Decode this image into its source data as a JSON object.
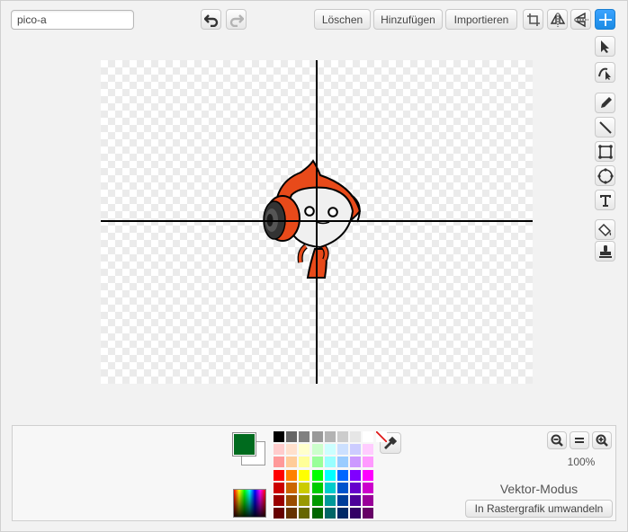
{
  "costume": {
    "name_value": "pico-a"
  },
  "toolbar": {
    "clear_label": "Löschen",
    "add_label": "Hinzufügen",
    "import_label": "Importieren"
  },
  "tools": [
    "select-tool",
    "reshape-tool",
    "pencil-tool",
    "line-tool",
    "rectangle-tool",
    "ellipse-tool",
    "text-tool",
    "fill-tool",
    "stamp-tool"
  ],
  "colors": {
    "primary": "#006b1e",
    "secondary": "#ffffff",
    "accent": "#1b8be5",
    "palette": [
      [
        "#000000",
        "#666666",
        "#808080",
        "#999999",
        "#b3b3b3",
        "#cccccc",
        "#e6e6e6",
        "#ffffff",
        "transparent"
      ],
      [
        "#ffcccc",
        "#ffe0cc",
        "#ffffcc",
        "#ccffcc",
        "#ccffff",
        "#cce0ff",
        "#ccccff",
        "#ffccff"
      ],
      [
        "#ff9999",
        "#ffcc99",
        "#ffff99",
        "#99ff99",
        "#99ffff",
        "#99ccff",
        "#cc99ff",
        "#ff99ff"
      ],
      [
        "#ff0000",
        "#ff8000",
        "#ffff00",
        "#00ff00",
        "#00ffff",
        "#0066ff",
        "#8000ff",
        "#ff00ff"
      ],
      [
        "#cc0000",
        "#cc6600",
        "#cccc00",
        "#00cc00",
        "#00cccc",
        "#0052cc",
        "#6600cc",
        "#cc00cc"
      ],
      [
        "#990000",
        "#994c00",
        "#999900",
        "#009900",
        "#009999",
        "#003d99",
        "#4c0099",
        "#990099"
      ],
      [
        "#660000",
        "#663300",
        "#666600",
        "#006600",
        "#006666",
        "#002966",
        "#330066",
        "#660066"
      ]
    ]
  },
  "zoom": {
    "level": "100%"
  },
  "mode": {
    "label": "Vektor-Modus",
    "convert_label": "In Rastergrafik umwandeln"
  }
}
